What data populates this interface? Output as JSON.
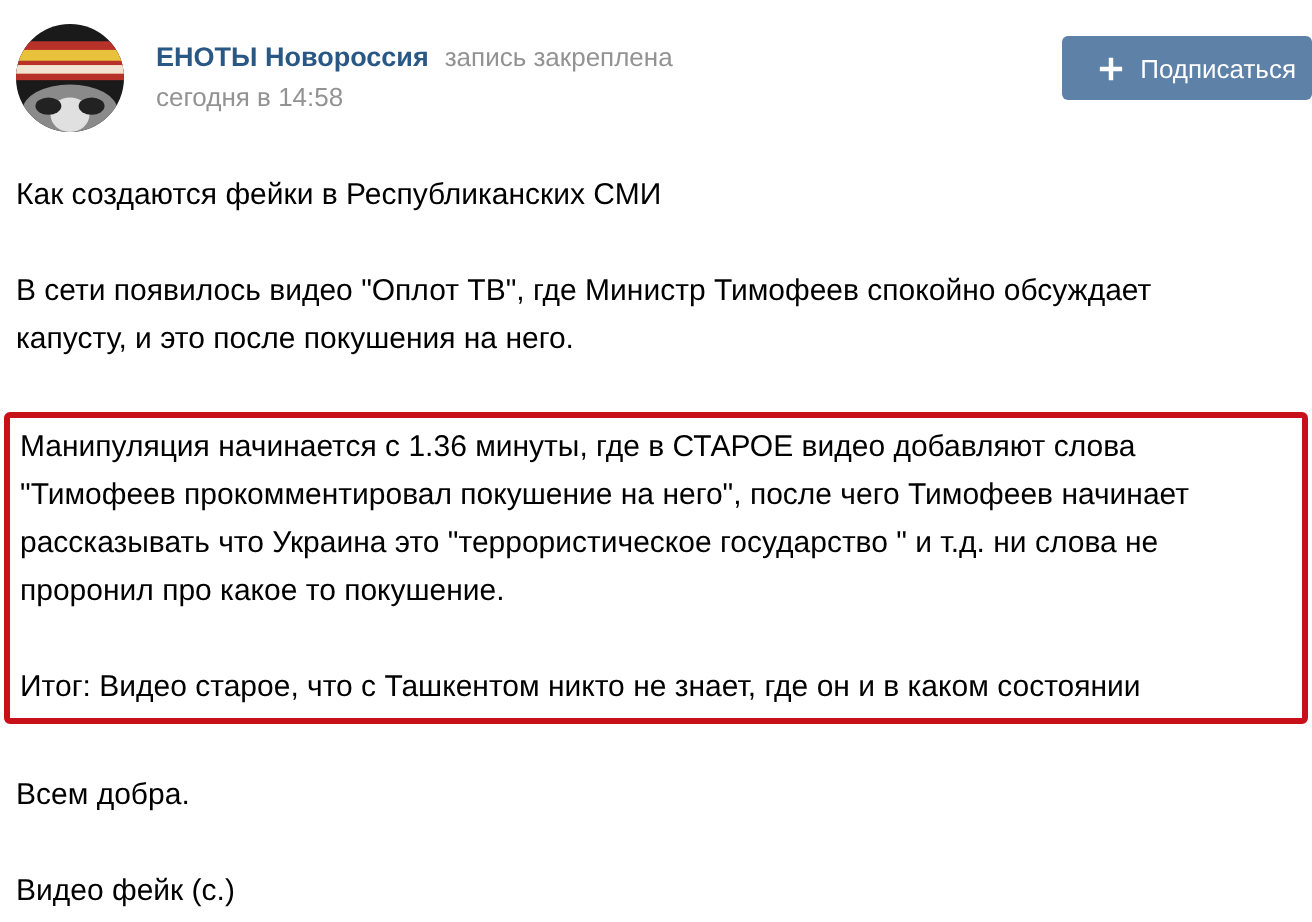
{
  "post": {
    "author": "ЕНОТЫ Новороссия",
    "pinned_note": "запись закреплена",
    "time": "сегодня в 14:58"
  },
  "subscribe_button": {
    "label": "Подписаться"
  },
  "body": [
    {
      "highlighted": false,
      "paragraphs": [
        "Как создаются фейки в Республиканских СМИ",
        "В сети появилось видео \"Оплот ТВ\", где Министр Тимофеев спокойно обсуждает капусту, и это после покушения на него."
      ]
    },
    {
      "highlighted": true,
      "paragraphs": [
        "Манипуляция начинается с 1.36 минуты, где в СТАРОЕ видео добавляют слова \"Тимофеев прокомментировал покушение на него\", после чего Тимофеев начинает рассказывать что Украина это \"террористическое государство \" и т.д. ни слова не проронил про какое то покушение.",
        "Итог: Видео старое, что с Ташкентом никто не знает, где он и в каком состоянии"
      ]
    },
    {
      "highlighted": false,
      "paragraphs": [
        "Всем добра.",
        "Видео фейк (с.)"
      ]
    }
  ]
}
